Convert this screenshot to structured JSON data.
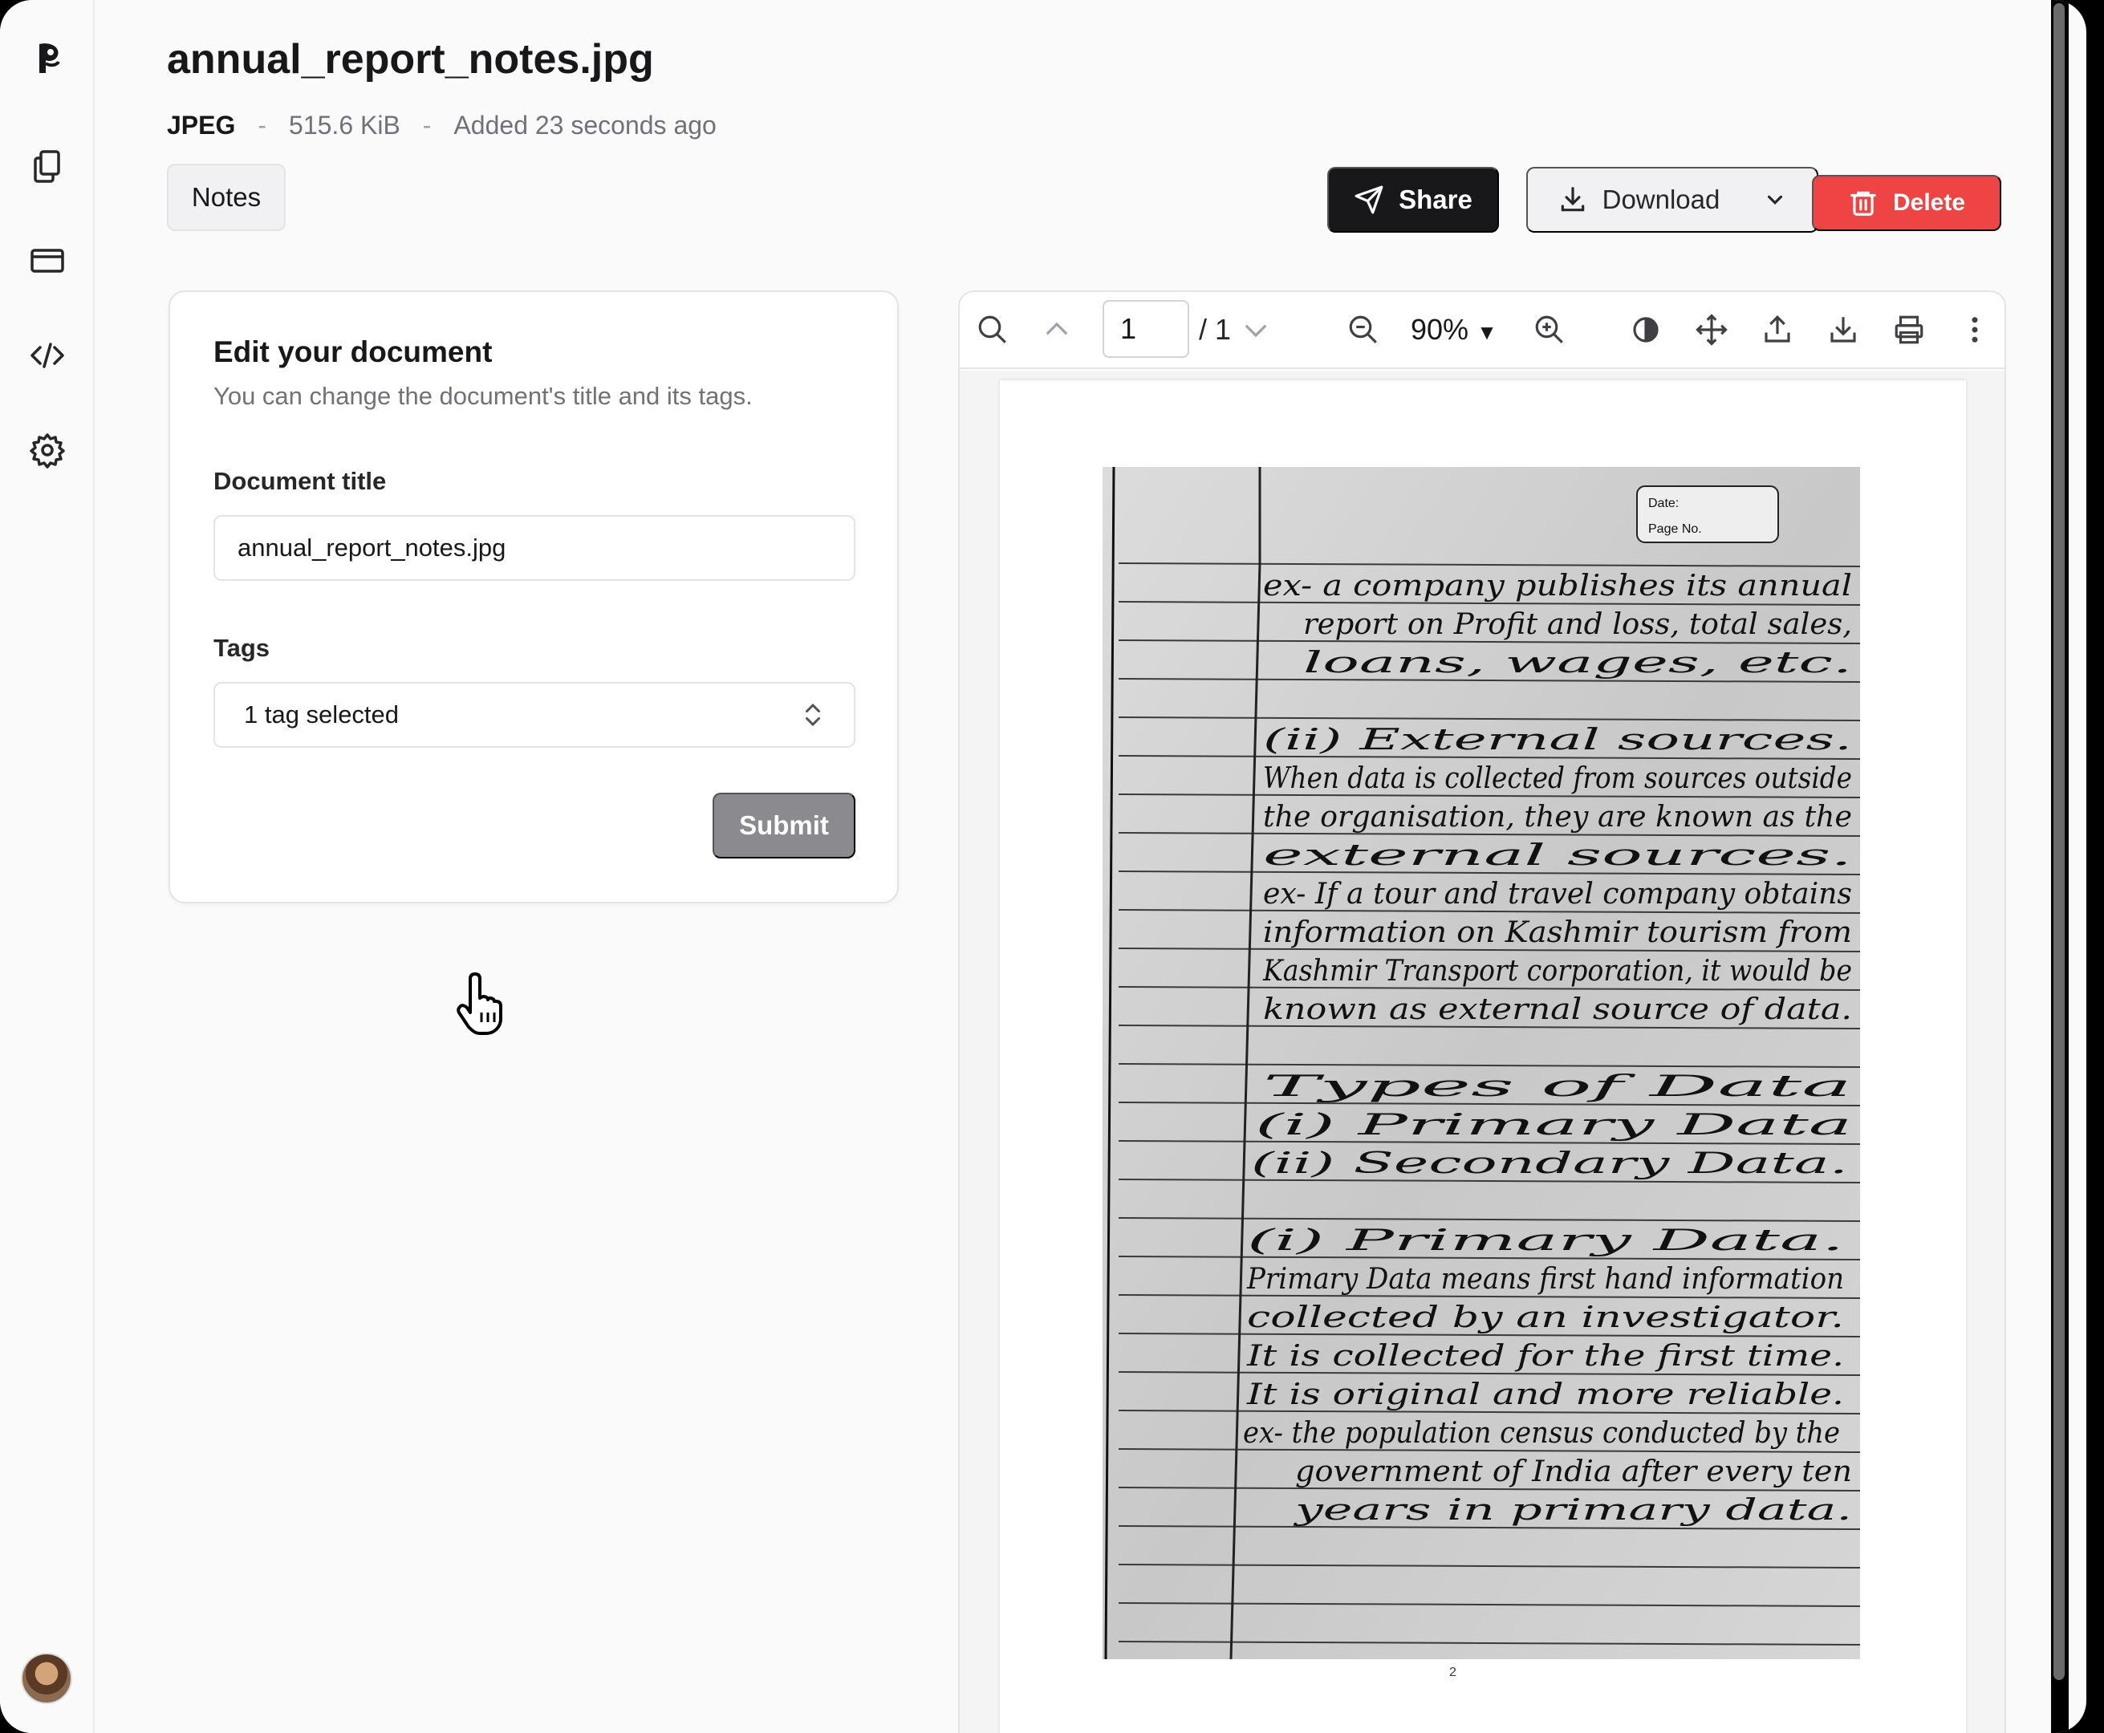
{
  "document": {
    "title": "annual_report_notes.jpg",
    "type": "JPEG",
    "size": "515.6 KiB",
    "added": "Added 23 seconds ago",
    "separator": "-",
    "tag": "Notes"
  },
  "actions": {
    "share": "Share",
    "download": "Download",
    "delete": "Delete"
  },
  "edit_form": {
    "heading": "Edit your document",
    "description": "You can change the document's title and its tags.",
    "title_label": "Document title",
    "title_value": "annual_report_notes.jpg",
    "tags_label": "Tags",
    "tags_value": "1 tag selected",
    "submit": "Submit"
  },
  "viewer": {
    "current_page": "1",
    "total_pages": "/ 1",
    "zoom": "90%",
    "page_number": "2"
  },
  "scan_text": {
    "date_label": "Date:",
    "page_label": "Page No.",
    "lines": [
      "ex- a company publishes its annual",
      "report on Profit and loss, total sales,",
      "loans, wages, etc.",
      "(ii) External sources.",
      "When data is collected from sources outside",
      "the organisation, they are known as the",
      "external sources.",
      "ex- If a tour and travel company obtains",
      "information on Kashmir tourism from",
      "Kashmir Transport corporation, it would be",
      "known as external source of data.",
      "Types of Data",
      "(i) Primary Data",
      "(ii) Secondary Data.",
      "(i) Primary Data.",
      "Primary Data means first hand information",
      "collected by an investigator.",
      "It is collected for the first time.",
      "It is original and more reliable.",
      "ex- the population census conducted by the",
      "government of India after every ten",
      "years in primary data."
    ]
  },
  "icons": {
    "logo": "paperless-logo-icon",
    "documents": "documents-icon",
    "billing": "credit-card-icon",
    "developer": "code-icon",
    "settings": "gear-icon"
  },
  "colors": {
    "primary": "#18181b",
    "danger": "#ef4444",
    "submit_disabled": "#8a8a8f",
    "background": "#fafafa"
  }
}
